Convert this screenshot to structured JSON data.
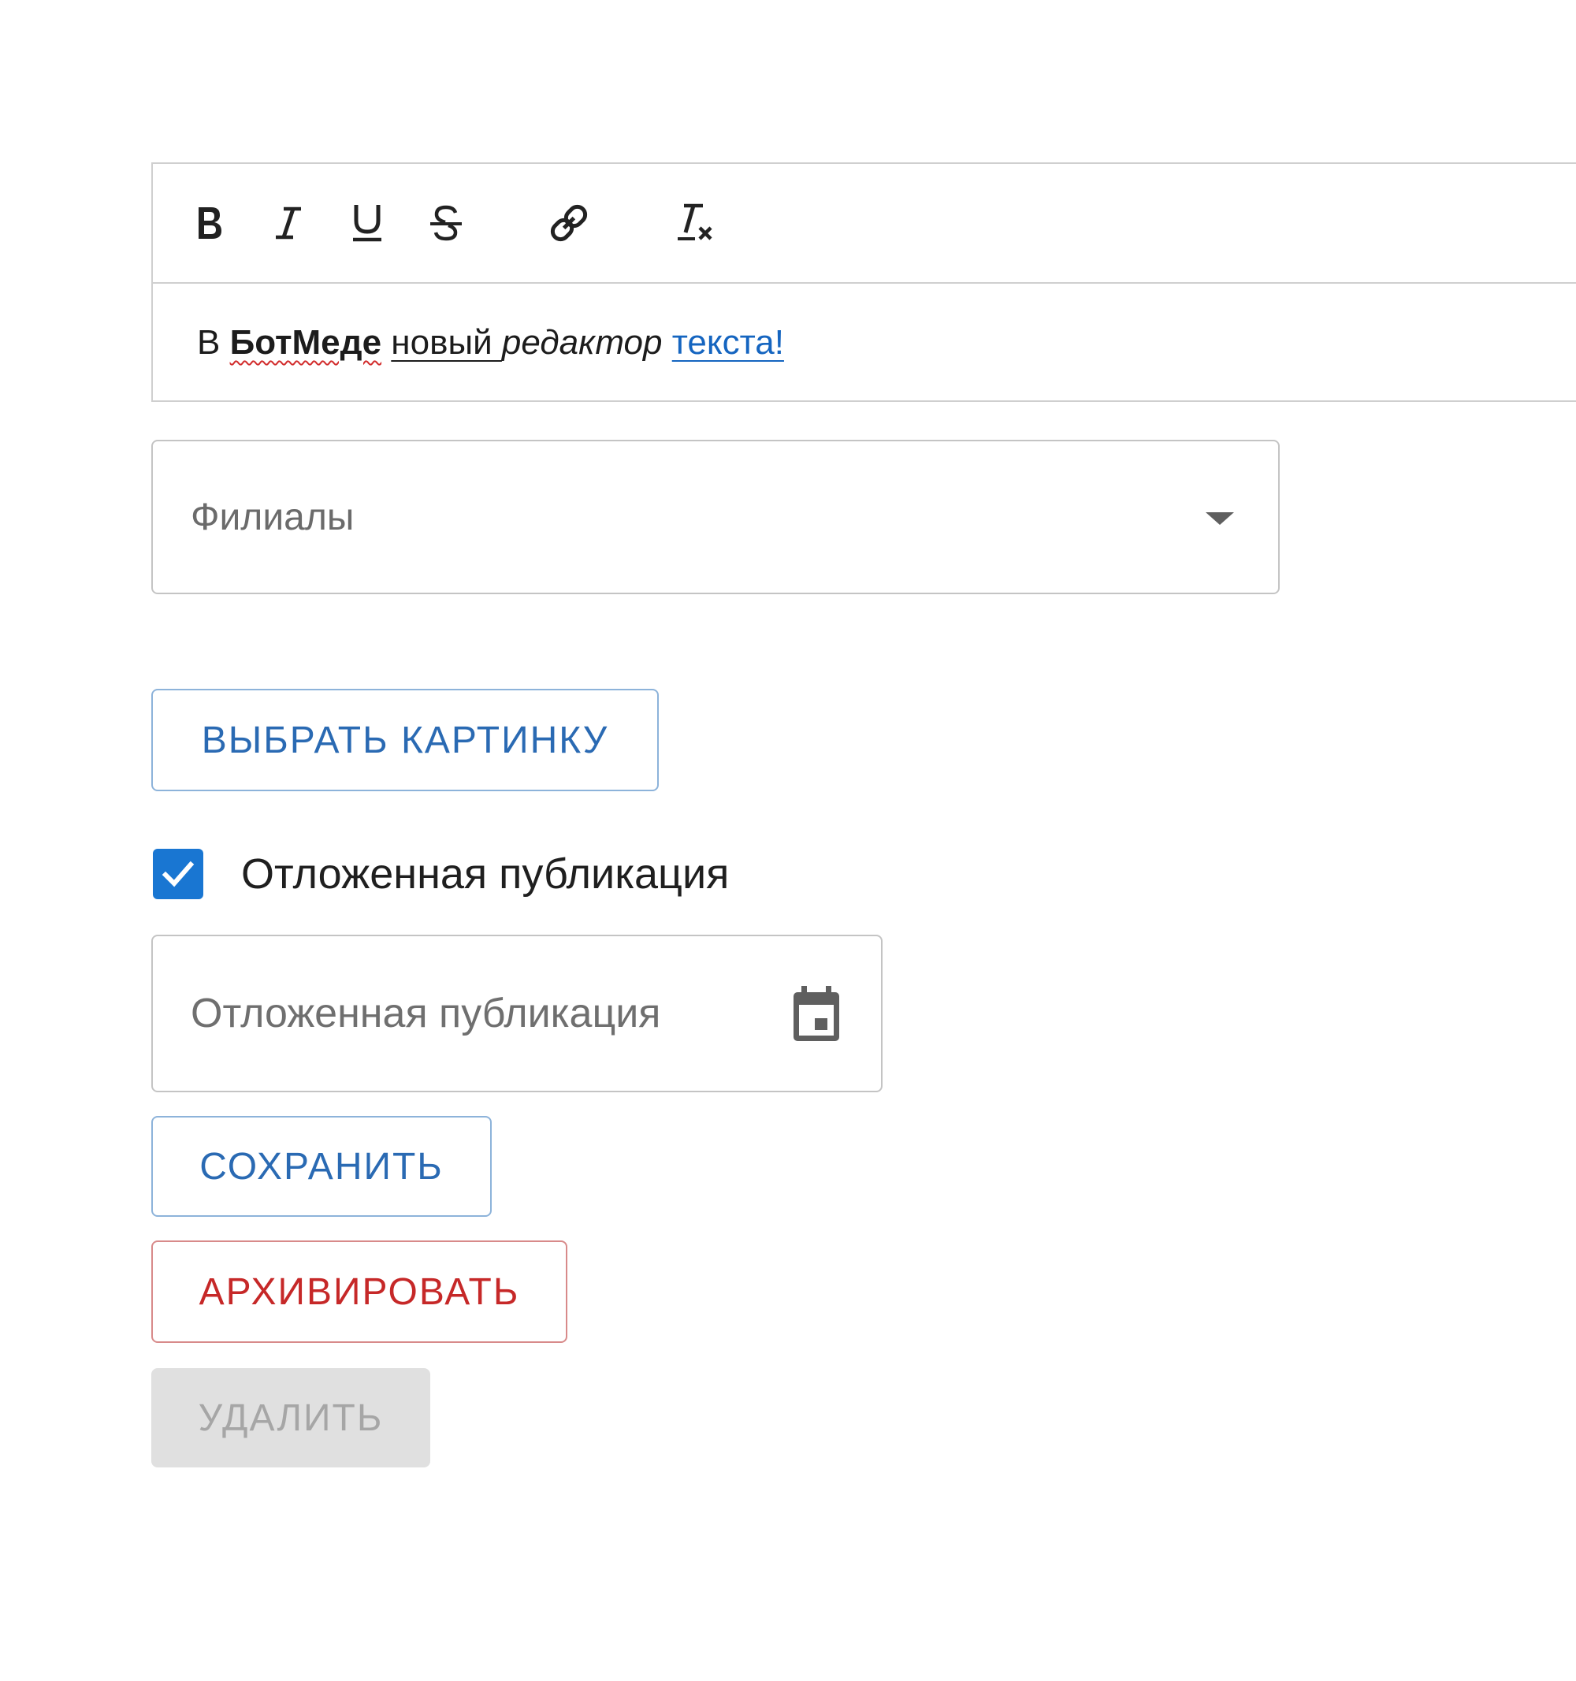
{
  "editor": {
    "toolbar": {
      "bold_title": "bold",
      "italic_title": "italic",
      "underline_title": "underline",
      "strike_title": "strike",
      "link_title": "link",
      "clean_title": "clean"
    },
    "content": {
      "part1": "В ",
      "part2": "БотМеде",
      "part3": " ",
      "part4": "новый ",
      "part5": "редактор",
      "part6": " ",
      "part7": "текста!"
    }
  },
  "branches_select": {
    "placeholder": "Филиалы"
  },
  "choose_image_button": {
    "label": "ВЫБРАТЬ КАРТИНКУ"
  },
  "delayed_publication": {
    "checkbox_label": "Отложенная публикация",
    "checked": true,
    "date_placeholder": "Отложенная публикация",
    "date_value": ""
  },
  "actions": {
    "save_label": "СОХРАНИТЬ",
    "archive_label": "АРХИВИРОВАТЬ",
    "delete_label": "УДАЛИТЬ"
  },
  "colors": {
    "primary": "#1976d2",
    "primary_text": "#2a6ab3",
    "danger": "#c62828",
    "disabled_bg": "#e0e0e0",
    "link": "#1565c0"
  },
  "icons": {
    "bold": "bold-icon",
    "italic": "italic-icon",
    "underline": "underline-icon",
    "strike": "strikethrough-icon",
    "link": "link-icon",
    "clean": "clear-format-icon",
    "dropdown": "chevron-down-icon",
    "checkbox": "checkmark-icon",
    "calendar": "calendar-icon"
  }
}
